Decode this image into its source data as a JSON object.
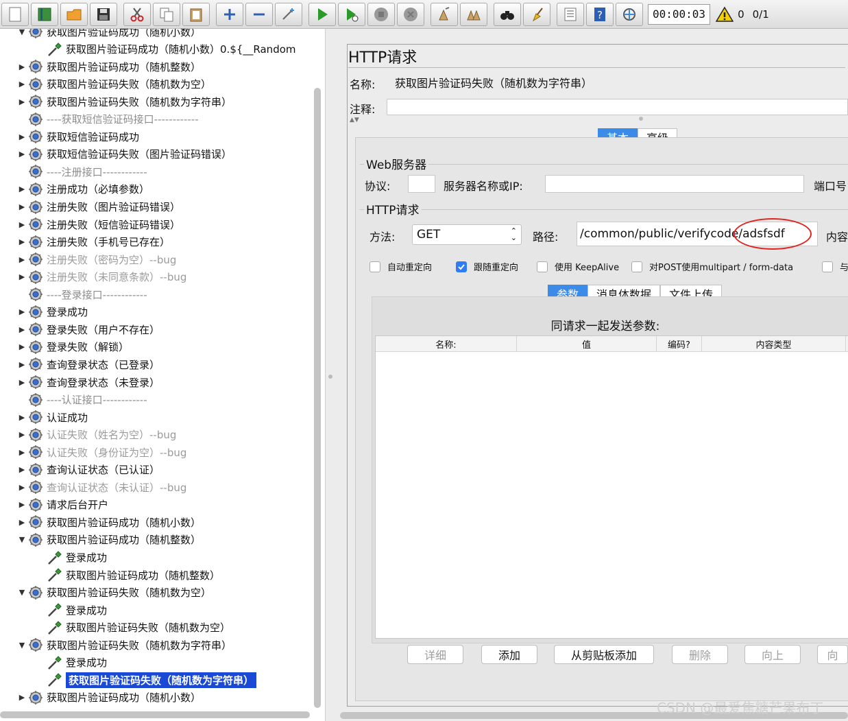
{
  "toolbar": {
    "timer": "00:00:03",
    "warning_count": "0",
    "thread_ratio": "0/1"
  },
  "tree": {
    "items": [
      {
        "label": "获取图片验证码成功（随机小数）",
        "level": 1,
        "arrow": "expanded",
        "state": "normal",
        "icon": "gear-icon"
      },
      {
        "label": "获取图片验证码成功（随机小数）0.${__Random",
        "level": 2,
        "arrow": "none",
        "state": "normal",
        "icon": "pipette-icon"
      },
      {
        "label": "获取图片验证码成功（随机整数）",
        "level": 1,
        "arrow": "collapsed",
        "state": "normal",
        "icon": "gear-icon"
      },
      {
        "label": "获取图片验证码失败（随机数为空）",
        "level": 1,
        "arrow": "collapsed",
        "state": "normal",
        "icon": "gear-icon"
      },
      {
        "label": "获取图片验证码失败（随机数为字符串）",
        "level": 1,
        "arrow": "collapsed",
        "state": "normal",
        "icon": "gear-icon"
      },
      {
        "label": "----获取短信验证码接口------------",
        "level": 1,
        "arrow": "none",
        "state": "sep",
        "icon": "gear-icon"
      },
      {
        "label": "获取短信验证码成功",
        "level": 1,
        "arrow": "collapsed",
        "state": "normal",
        "icon": "gear-icon"
      },
      {
        "label": "获取短信验证码失败（图片验证码错误）",
        "level": 1,
        "arrow": "collapsed",
        "state": "normal",
        "icon": "gear-icon"
      },
      {
        "label": "----注册接口------------",
        "level": 1,
        "arrow": "none",
        "state": "sep",
        "icon": "gear-icon"
      },
      {
        "label": "注册成功（必填参数）",
        "level": 1,
        "arrow": "collapsed",
        "state": "normal",
        "icon": "gear-icon"
      },
      {
        "label": "注册失败（图片验证码错误）",
        "level": 1,
        "arrow": "collapsed",
        "state": "normal",
        "icon": "gear-icon"
      },
      {
        "label": "注册失败（短信验证码错误）",
        "level": 1,
        "arrow": "collapsed",
        "state": "normal",
        "icon": "gear-icon"
      },
      {
        "label": "注册失败（手机号已存在）",
        "level": 1,
        "arrow": "collapsed",
        "state": "normal",
        "icon": "gear-icon"
      },
      {
        "label": "注册失败（密码为空）--bug",
        "level": 1,
        "arrow": "collapsed",
        "state": "disabled",
        "icon": "gear-icon"
      },
      {
        "label": "注册失败（未同意条款）--bug",
        "level": 1,
        "arrow": "collapsed",
        "state": "disabled",
        "icon": "gear-icon"
      },
      {
        "label": "----登录接口------------",
        "level": 1,
        "arrow": "none",
        "state": "sep",
        "icon": "gear-icon"
      },
      {
        "label": "登录成功",
        "level": 1,
        "arrow": "collapsed",
        "state": "normal",
        "icon": "gear-icon"
      },
      {
        "label": "登录失败（用户不存在）",
        "level": 1,
        "arrow": "collapsed",
        "state": "normal",
        "icon": "gear-icon"
      },
      {
        "label": "登录失败（解锁）",
        "level": 1,
        "arrow": "collapsed",
        "state": "normal",
        "icon": "gear-icon"
      },
      {
        "label": "查询登录状态（已登录）",
        "level": 1,
        "arrow": "collapsed",
        "state": "normal",
        "icon": "gear-icon"
      },
      {
        "label": "查询登录状态（未登录）",
        "level": 1,
        "arrow": "collapsed",
        "state": "normal",
        "icon": "gear-icon"
      },
      {
        "label": "----认证接口------------",
        "level": 1,
        "arrow": "none",
        "state": "sep",
        "icon": "gear-icon"
      },
      {
        "label": "认证成功",
        "level": 1,
        "arrow": "collapsed",
        "state": "normal",
        "icon": "gear-icon"
      },
      {
        "label": "认证失败（姓名为空）--bug",
        "level": 1,
        "arrow": "collapsed",
        "state": "disabled",
        "icon": "gear-icon"
      },
      {
        "label": "认证失败（身份证为空）--bug",
        "level": 1,
        "arrow": "collapsed",
        "state": "disabled",
        "icon": "gear-icon"
      },
      {
        "label": "查询认证状态（已认证）",
        "level": 1,
        "arrow": "collapsed",
        "state": "normal",
        "icon": "gear-icon"
      },
      {
        "label": "查询认证状态（未认证）--bug",
        "level": 1,
        "arrow": "collapsed",
        "state": "disabled",
        "icon": "gear-icon"
      },
      {
        "label": "请求后台开户",
        "level": 1,
        "arrow": "collapsed",
        "state": "normal",
        "icon": "gear-icon"
      },
      {
        "label": "获取图片验证码成功（随机小数）",
        "level": 1,
        "arrow": "collapsed",
        "state": "normal",
        "icon": "gear-icon"
      },
      {
        "label": "获取图片验证码成功（随机整数）",
        "level": 1,
        "arrow": "expanded",
        "state": "normal",
        "icon": "gear-icon"
      },
      {
        "label": "登录成功",
        "level": 2,
        "arrow": "none",
        "state": "normal",
        "icon": "pipette-icon"
      },
      {
        "label": "获取图片验证码成功（随机整数）",
        "level": 2,
        "arrow": "none",
        "state": "normal",
        "icon": "pipette-icon"
      },
      {
        "label": "获取图片验证码失败（随机数为空）",
        "level": 1,
        "arrow": "expanded",
        "state": "normal",
        "icon": "gear-icon"
      },
      {
        "label": "登录成功",
        "level": 2,
        "arrow": "none",
        "state": "normal",
        "icon": "pipette-icon"
      },
      {
        "label": "获取图片验证码失败（随机数为空）",
        "level": 2,
        "arrow": "none",
        "state": "normal",
        "icon": "pipette-icon"
      },
      {
        "label": "获取图片验证码失败（随机数为字符串）",
        "level": 1,
        "arrow": "expanded",
        "state": "normal",
        "icon": "gear-icon"
      },
      {
        "label": "登录成功",
        "level": 2,
        "arrow": "none",
        "state": "normal",
        "icon": "pipette-icon"
      },
      {
        "label": "获取图片验证码失败（随机数为字符串）",
        "level": 2,
        "arrow": "none",
        "state": "selected",
        "icon": "pipette-icon"
      },
      {
        "label": "获取图片验证码成功（随机小数）",
        "level": 1,
        "arrow": "collapsed",
        "state": "normal",
        "icon": "gear-icon"
      }
    ]
  },
  "http": {
    "title": "HTTP请求",
    "name_label": "名称:",
    "name_value": "获取图片验证码失败（随机数为字符串）",
    "comment_label": "注释:",
    "comment_value": "",
    "tabs": [
      "基本",
      "高级"
    ],
    "web_server": {
      "group_title": "Web服务器",
      "protocol_label": "协议:",
      "protocol_value": "",
      "server_label": "服务器名称或IP:",
      "server_value": "",
      "port_label": "端口号"
    },
    "request": {
      "group_title": "HTTP请求",
      "method_label": "方法:",
      "method_value": "GET",
      "path_label": "路径:",
      "path_value": "/common/public/verifycode/adsfsdf",
      "content_label": "内容"
    },
    "checkboxes": [
      {
        "label": "自动重定向",
        "checked": false
      },
      {
        "label": "跟随重定向",
        "checked": true
      },
      {
        "label": "使用 KeepAlive",
        "checked": false
      },
      {
        "label": "对POST使用multipart / form-data",
        "checked": false
      },
      {
        "label": "与",
        "checked": false
      }
    ],
    "sub_tabs": [
      "参数",
      "消息体数据",
      "文件上传"
    ],
    "params_caption": "同请求一起发送参数:",
    "table_headers": [
      "名称:",
      "值",
      "编码?",
      "内容类型"
    ],
    "buttons": [
      {
        "label": "详细",
        "enabled": false
      },
      {
        "label": "添加",
        "enabled": true
      },
      {
        "label": "从剪贴板添加",
        "enabled": true
      },
      {
        "label": "删除",
        "enabled": false
      },
      {
        "label": "向上",
        "enabled": false
      },
      {
        "label": "向",
        "enabled": false
      }
    ]
  },
  "watermark": "CSDN @最爱焦糖芒果布丁",
  "colors": {
    "selection": "#1a49d6",
    "tab_active": "#3d8be8",
    "annotation_circle": "#e0231e"
  }
}
